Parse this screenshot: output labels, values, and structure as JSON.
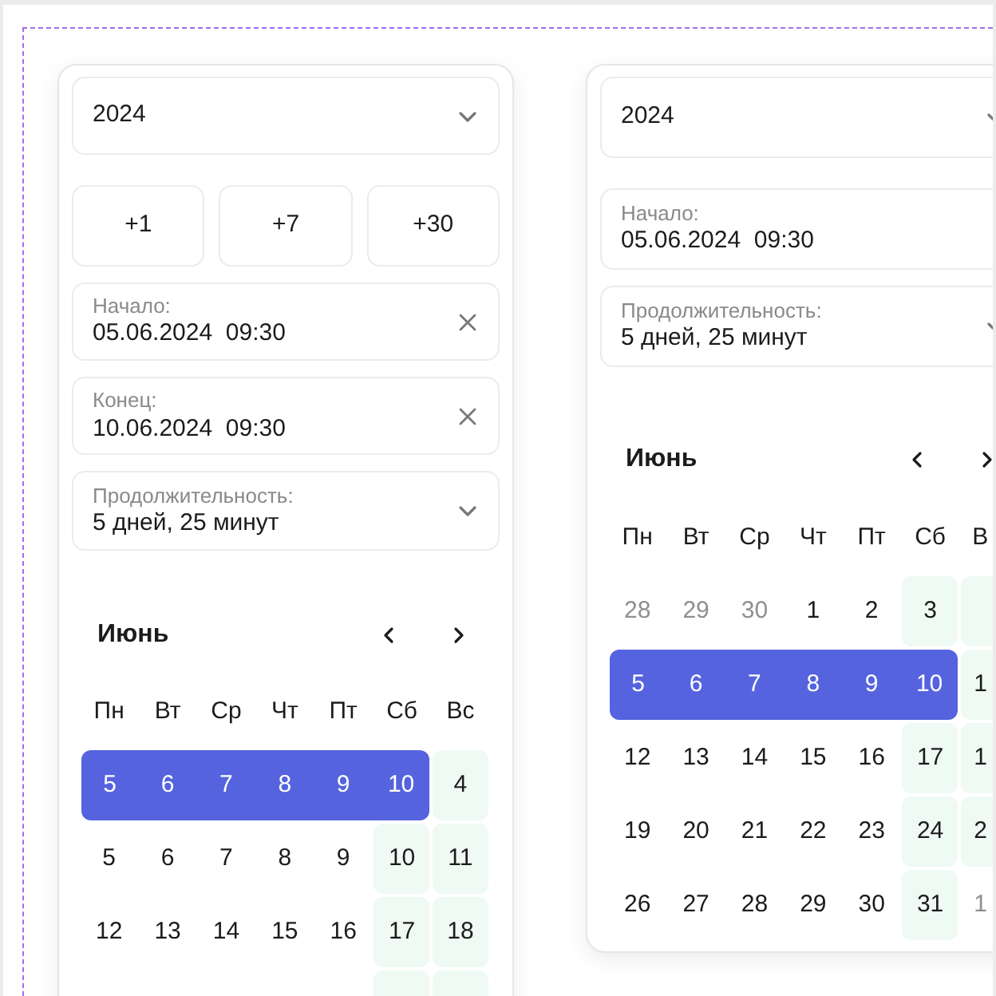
{
  "panels": [
    {
      "year_select": {
        "value": "2024"
      },
      "quick_buttons": [
        "+1",
        "+7",
        "+30"
      ],
      "fields": [
        {
          "kind": "date",
          "label": "Начало:",
          "value": "05.06.2024  09:30",
          "clearable": true
        },
        {
          "kind": "date",
          "label": "Конец:",
          "value": "10.06.2024  09:30",
          "clearable": true
        },
        {
          "kind": "duration",
          "label": "Продолжительность:",
          "value": "5 дней, 25 минут"
        }
      ],
      "calendar": {
        "month": "Июнь",
        "weekdays": [
          "Пн",
          "Вт",
          "Ср",
          "Чт",
          "Пт",
          "Сб",
          "Вс"
        ],
        "rows": [
          [
            {
              "text": "5",
              "selected": true,
              "weekend": false,
              "muted": false
            },
            {
              "text": "6",
              "selected": true,
              "weekend": false,
              "muted": false
            },
            {
              "text": "7",
              "selected": true,
              "weekend": false,
              "muted": false
            },
            {
              "text": "8",
              "selected": true,
              "weekend": false,
              "muted": false
            },
            {
              "text": "9",
              "selected": true,
              "weekend": false,
              "muted": false
            },
            {
              "text": "10",
              "selected": true,
              "weekend": true,
              "muted": false
            },
            {
              "text": "4",
              "selected": false,
              "weekend": true,
              "muted": false
            }
          ],
          [
            {
              "text": "5",
              "selected": false,
              "weekend": false,
              "muted": false
            },
            {
              "text": "6",
              "selected": false,
              "weekend": false,
              "muted": false
            },
            {
              "text": "7",
              "selected": false,
              "weekend": false,
              "muted": false
            },
            {
              "text": "8",
              "selected": false,
              "weekend": false,
              "muted": false
            },
            {
              "text": "9",
              "selected": false,
              "weekend": false,
              "muted": false
            },
            {
              "text": "10",
              "selected": false,
              "weekend": true,
              "muted": false
            },
            {
              "text": "11",
              "selected": false,
              "weekend": true,
              "muted": false
            }
          ],
          [
            {
              "text": "12",
              "selected": false,
              "weekend": false,
              "muted": false
            },
            {
              "text": "13",
              "selected": false,
              "weekend": false,
              "muted": false
            },
            {
              "text": "14",
              "selected": false,
              "weekend": false,
              "muted": false
            },
            {
              "text": "15",
              "selected": false,
              "weekend": false,
              "muted": false
            },
            {
              "text": "16",
              "selected": false,
              "weekend": false,
              "muted": false
            },
            {
              "text": "17",
              "selected": false,
              "weekend": true,
              "muted": false
            },
            {
              "text": "18",
              "selected": false,
              "weekend": true,
              "muted": false
            }
          ],
          [
            {},
            {},
            {},
            {},
            {},
            {
              "selected": false,
              "weekend": true
            },
            {
              "selected": false,
              "weekend": true
            }
          ]
        ]
      }
    },
    {
      "year_select": {
        "value": "2024"
      },
      "fields": [
        {
          "kind": "date",
          "label": "Начало:",
          "value": "05.06.2024  09:30"
        },
        {
          "kind": "duration",
          "label": "Продолжительность:",
          "value": "5 дней, 25 минут"
        }
      ],
      "calendar": {
        "month": "Июнь",
        "weekdays": [
          "Пн",
          "Вт",
          "Ср",
          "Чт",
          "Пт",
          "Сб",
          "В"
        ],
        "rows": [
          [
            {
              "text": "28",
              "selected": false,
              "weekend": false,
              "muted": true
            },
            {
              "text": "29",
              "selected": false,
              "weekend": false,
              "muted": true
            },
            {
              "text": "30",
              "selected": false,
              "weekend": false,
              "muted": true
            },
            {
              "text": "1",
              "selected": false,
              "weekend": false,
              "muted": false
            },
            {
              "text": "2",
              "selected": false,
              "weekend": false,
              "muted": false
            },
            {
              "text": "3",
              "selected": false,
              "weekend": true,
              "muted": false
            },
            {
              "selected": false,
              "weekend": true
            }
          ],
          [
            {
              "text": "5",
              "selected": true,
              "weekend": false,
              "muted": false
            },
            {
              "text": "6",
              "selected": true,
              "weekend": false,
              "muted": false
            },
            {
              "text": "7",
              "selected": true,
              "weekend": false,
              "muted": false
            },
            {
              "text": "8",
              "selected": true,
              "weekend": false,
              "muted": false
            },
            {
              "text": "9",
              "selected": true,
              "weekend": false,
              "muted": false
            },
            {
              "text": "10",
              "selected": true,
              "weekend": true,
              "muted": false
            },
            {
              "text": "1",
              "selected": false,
              "weekend": true,
              "muted": false
            }
          ],
          [
            {
              "text": "12",
              "selected": false,
              "weekend": false,
              "muted": false
            },
            {
              "text": "13",
              "selected": false,
              "weekend": false,
              "muted": false
            },
            {
              "text": "14",
              "selected": false,
              "weekend": false,
              "muted": false
            },
            {
              "text": "15",
              "selected": false,
              "weekend": false,
              "muted": false
            },
            {
              "text": "16",
              "selected": false,
              "weekend": false,
              "muted": false
            },
            {
              "text": "17",
              "selected": false,
              "weekend": true,
              "muted": false
            },
            {
              "text": "1",
              "selected": false,
              "weekend": true,
              "muted": false
            }
          ],
          [
            {
              "text": "19",
              "selected": false,
              "weekend": false,
              "muted": false
            },
            {
              "text": "20",
              "selected": false,
              "weekend": false,
              "muted": false
            },
            {
              "text": "21",
              "selected": false,
              "weekend": false,
              "muted": false
            },
            {
              "text": "22",
              "selected": false,
              "weekend": false,
              "muted": false
            },
            {
              "text": "23",
              "selected": false,
              "weekend": false,
              "muted": false
            },
            {
              "text": "24",
              "selected": false,
              "weekend": true,
              "muted": false
            },
            {
              "text": "2",
              "selected": false,
              "weekend": true,
              "muted": false
            }
          ],
          [
            {
              "text": "26",
              "selected": false,
              "weekend": false,
              "muted": false
            },
            {
              "text": "27",
              "selected": false,
              "weekend": false,
              "muted": false
            },
            {
              "text": "28",
              "selected": false,
              "weekend": false,
              "muted": false
            },
            {
              "text": "29",
              "selected": false,
              "weekend": false,
              "muted": false
            },
            {
              "text": "30",
              "selected": false,
              "weekend": false,
              "muted": false
            },
            {
              "text": "31",
              "selected": false,
              "weekend": true,
              "muted": false
            },
            {
              "text": "1",
              "selected": false,
              "weekend": false,
              "muted": true
            }
          ]
        ]
      }
    }
  ]
}
